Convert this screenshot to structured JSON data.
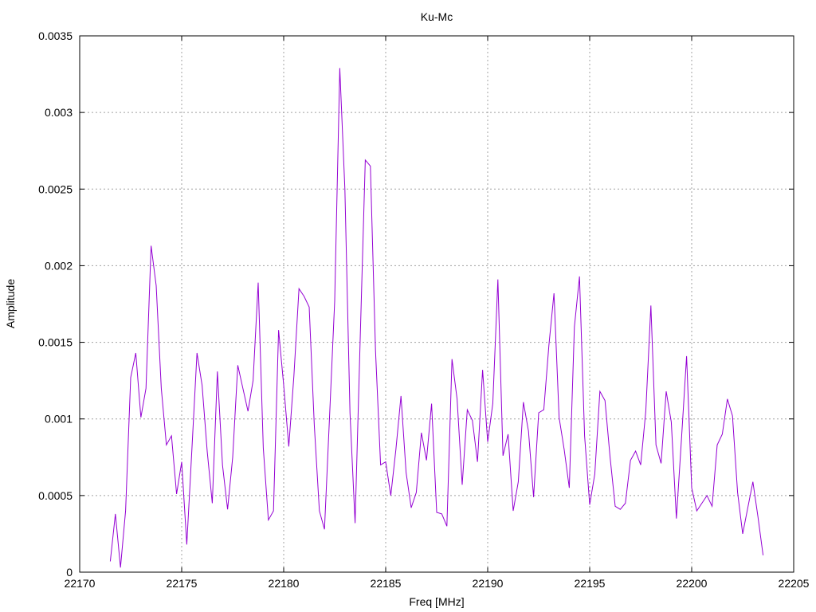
{
  "chart_data": {
    "type": "line",
    "title": "Ku-Mc",
    "xlabel": "Freq [MHz]",
    "ylabel": "Amplitude",
    "xlim": [
      22170,
      22205
    ],
    "ylim": [
      0,
      0.0035
    ],
    "x_ticks": [
      "22170",
      "22175",
      "22180",
      "22185",
      "22190",
      "22195",
      "22200",
      "22205"
    ],
    "y_ticks": [
      "0",
      "0.0005",
      "0.001",
      "0.0015",
      "0.002",
      "0.0025",
      "0.003",
      "0.0035"
    ],
    "grid": true,
    "series": [
      {
        "color": "#9400d3",
        "x": [
          22171.5,
          22171.75,
          22172.0,
          22172.25,
          22172.5,
          22172.75,
          22173.0,
          22173.25,
          22173.5,
          22173.75,
          22174.0,
          22174.25,
          22174.5,
          22174.75,
          22175.0,
          22175.25,
          22175.5,
          22175.75,
          22176.0,
          22176.25,
          22176.5,
          22176.75,
          22177.0,
          22177.25,
          22177.5,
          22177.75,
          22178.0,
          22178.25,
          22178.5,
          22178.75,
          22179.0,
          22179.25,
          22179.5,
          22179.75,
          22180.0,
          22180.25,
          22180.5,
          22180.75,
          22181.0,
          22181.25,
          22181.5,
          22181.75,
          22182.0,
          22182.25,
          22182.5,
          22182.75,
          22183.0,
          22183.25,
          22183.5,
          22183.75,
          22184.0,
          22184.25,
          22184.5,
          22184.75,
          22185.0,
          22185.25,
          22185.5,
          22185.75,
          22186.0,
          22186.25,
          22186.5,
          22186.75,
          22187.0,
          22187.25,
          22187.5,
          22187.75,
          22188.0,
          22188.25,
          22188.5,
          22188.75,
          22189.0,
          22189.25,
          22189.5,
          22189.75,
          22190.0,
          22190.25,
          22190.5,
          22190.75,
          22191.0,
          22191.25,
          22191.5,
          22191.75,
          22192.0,
          22192.25,
          22192.5,
          22192.75,
          22193.0,
          22193.25,
          22193.5,
          22193.75,
          22194.0,
          22194.25,
          22194.5,
          22194.75,
          22195.0,
          22195.25,
          22195.5,
          22195.75,
          22196.0,
          22196.25,
          22196.5,
          22196.75,
          22197.0,
          22197.25,
          22197.5,
          22197.75,
          22198.0,
          22198.25,
          22198.5,
          22198.75,
          22199.0,
          22199.25,
          22199.5,
          22199.75,
          22200.0,
          22200.25,
          22200.5,
          22200.75,
          22201.0,
          22201.25,
          22201.5,
          22201.75,
          22202.0,
          22202.25,
          22202.5,
          22202.75,
          22203.0,
          22203.25,
          22203.5
        ],
        "y": [
          7e-05,
          0.00038,
          3e-05,
          0.0004,
          0.00127,
          0.00143,
          0.00101,
          0.0012,
          0.00213,
          0.00187,
          0.0012,
          0.00083,
          0.00089,
          0.00051,
          0.00072,
          0.00018,
          0.0008,
          0.00143,
          0.00122,
          0.00079,
          0.00045,
          0.00131,
          0.0007,
          0.00041,
          0.00075,
          0.00135,
          0.0012,
          0.00105,
          0.00125,
          0.00189,
          0.00081,
          0.00034,
          0.0004,
          0.00158,
          0.00122,
          0.00082,
          0.00128,
          0.00185,
          0.0018,
          0.00173,
          0.00096,
          0.0004,
          0.00028,
          0.00102,
          0.00177,
          0.00329,
          0.0025,
          0.00104,
          0.00032,
          0.00152,
          0.00269,
          0.00265,
          0.00145,
          0.0007,
          0.00072,
          0.0005,
          0.0008,
          0.00115,
          0.00065,
          0.00042,
          0.00052,
          0.00091,
          0.00073,
          0.0011,
          0.00039,
          0.00038,
          0.0003,
          0.00139,
          0.00113,
          0.00057,
          0.00106,
          0.00099,
          0.00072,
          0.00132,
          0.00085,
          0.0011,
          0.00191,
          0.00076,
          0.0009,
          0.0004,
          0.00059,
          0.00111,
          0.00092,
          0.00049,
          0.00104,
          0.00106,
          0.00148,
          0.00182,
          0.00101,
          0.0008,
          0.00055,
          0.0016,
          0.00193,
          0.00089,
          0.00044,
          0.00064,
          0.00118,
          0.00112,
          0.00075,
          0.00043,
          0.00041,
          0.00045,
          0.00073,
          0.00079,
          0.0007,
          0.00105,
          0.00174,
          0.00083,
          0.00071,
          0.00118,
          0.00098,
          0.00035,
          0.00087,
          0.00141,
          0.00055,
          0.0004,
          0.00045,
          0.0005,
          0.00043,
          0.00083,
          0.0009,
          0.00113,
          0.00102,
          0.00052,
          0.00025,
          0.00042,
          0.00059,
          0.00036,
          0.00011
        ]
      }
    ]
  }
}
